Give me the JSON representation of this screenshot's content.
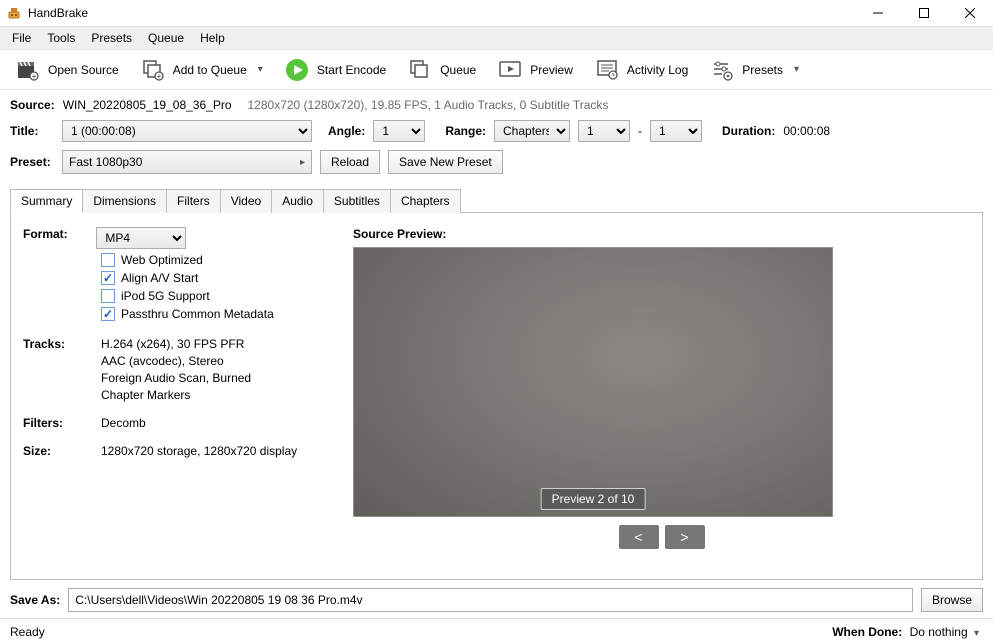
{
  "app": {
    "title": "HandBrake"
  },
  "menu": {
    "items": [
      "File",
      "Tools",
      "Presets",
      "Queue",
      "Help"
    ]
  },
  "toolbar": {
    "open_source": "Open Source",
    "add_to_queue": "Add to Queue",
    "start_encode": "Start Encode",
    "queue": "Queue",
    "preview": "Preview",
    "activity_log": "Activity Log",
    "presets": "Presets"
  },
  "source": {
    "label": "Source:",
    "name": "WIN_20220805_19_08_36_Pro",
    "info": "1280x720 (1280x720), 19.85 FPS, 1 Audio Tracks, 0 Subtitle Tracks"
  },
  "title_row": {
    "title_label": "Title:",
    "title_value": "1  (00:00:08)",
    "angle_label": "Angle:",
    "angle_value": "1",
    "range_label": "Range:",
    "range_type": "Chapters",
    "range_from": "1",
    "range_sep": "-",
    "range_to": "1",
    "duration_label": "Duration:",
    "duration_value": "00:00:08"
  },
  "preset_row": {
    "label": "Preset:",
    "value": "Fast 1080p30",
    "reload": "Reload",
    "save_new": "Save New Preset"
  },
  "tabs": [
    "Summary",
    "Dimensions",
    "Filters",
    "Video",
    "Audio",
    "Subtitles",
    "Chapters"
  ],
  "summary": {
    "format_label": "Format:",
    "format_value": "MP4",
    "checkboxes": [
      {
        "label": "Web Optimized",
        "checked": false
      },
      {
        "label": "Align A/V Start",
        "checked": true
      },
      {
        "label": "iPod 5G Support",
        "checked": false
      },
      {
        "label": "Passthru Common Metadata",
        "checked": true
      }
    ],
    "tracks_label": "Tracks:",
    "tracks": [
      "H.264 (x264), 30 FPS PFR",
      "AAC (avcodec), Stereo",
      "Foreign Audio Scan, Burned",
      "Chapter Markers"
    ],
    "filters_label": "Filters:",
    "filters_value": "Decomb",
    "size_label": "Size:",
    "size_value": "1280x720 storage, 1280x720 display",
    "preview_label": "Source Preview:",
    "preview_badge": "Preview 2 of 10",
    "prev": "<",
    "next": ">"
  },
  "save": {
    "label": "Save As:",
    "path": "C:\\Users\\dell\\Videos\\Win 20220805 19 08 36 Pro.m4v",
    "browse": "Browse"
  },
  "status": {
    "ready": "Ready",
    "when_done_label": "When Done:",
    "when_done_value": "Do nothing"
  }
}
